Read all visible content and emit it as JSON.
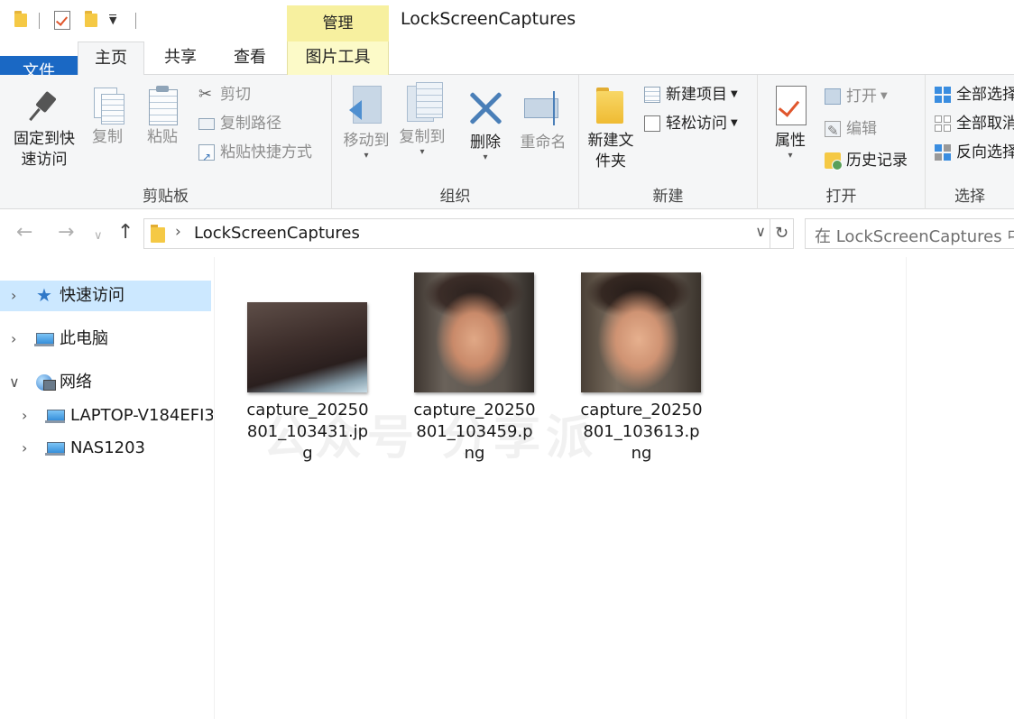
{
  "window": {
    "title": "LockScreenCaptures",
    "context_tab": "管理"
  },
  "ribbon_tabs": {
    "file": "文件",
    "home": "主页",
    "share": "共享",
    "view": "查看",
    "picture_tools": "图片工具"
  },
  "clipboard": {
    "pin": "固定到快速访问",
    "copy": "复制",
    "paste": "粘贴",
    "cut": "剪切",
    "copy_path": "复制路径",
    "paste_shortcut": "粘贴快捷方式",
    "label": "剪贴板"
  },
  "organize": {
    "move_to": "移动到",
    "copy_to": "复制到",
    "delete": "删除",
    "rename": "重命名",
    "label": "组织"
  },
  "new": {
    "new_folder": "新建文件夹",
    "new_item": "新建项目",
    "easy_access": "轻松访问",
    "label": "新建"
  },
  "open": {
    "properties": "属性",
    "open": "打开",
    "edit": "编辑",
    "history": "历史记录",
    "label": "打开"
  },
  "select": {
    "select_all": "全部选择",
    "select_none": "全部取消",
    "invert": "反向选择",
    "label": "选择"
  },
  "address": {
    "path": "LockScreenCaptures",
    "search_placeholder": "在 LockScreenCaptures 中搜索"
  },
  "nav": {
    "quick_access": "快速访问",
    "this_pc": "此电脑",
    "network": "网络",
    "hosts": [
      "LAPTOP-V184EFI3",
      "NAS1203"
    ]
  },
  "files": [
    {
      "name": "capture_20250801_103431.jpg"
    },
    {
      "name": "capture_20250801_103459.png"
    },
    {
      "name": "capture_20250801_103613.png"
    }
  ],
  "watermark": "公众号 分享派"
}
